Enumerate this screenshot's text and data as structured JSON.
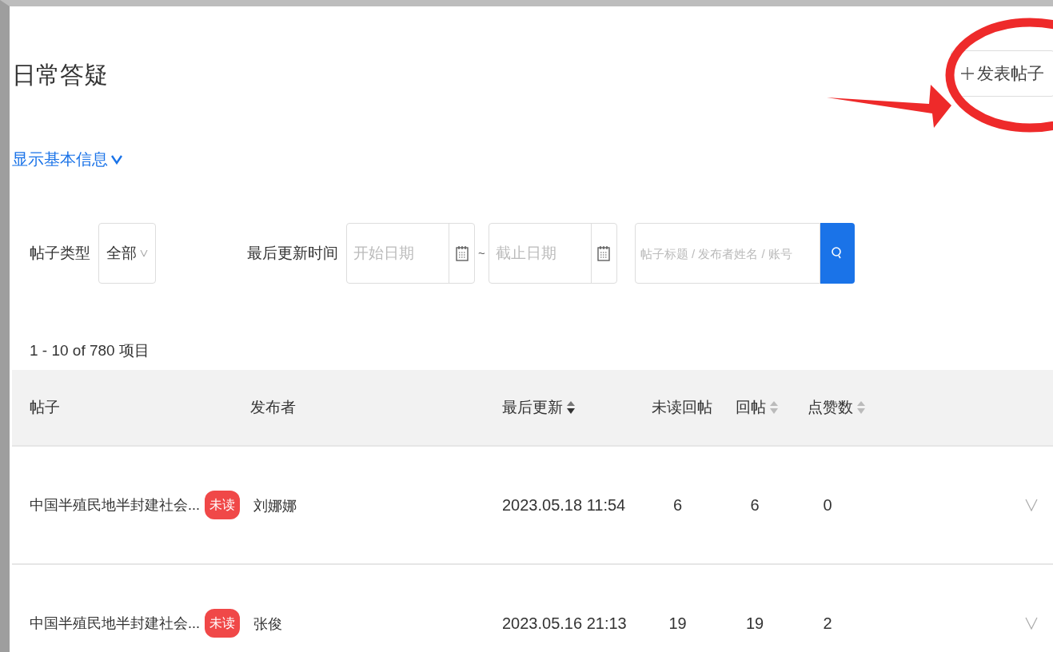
{
  "page": {
    "title": "日常答疑",
    "new_post_button": "发表帖子",
    "toggle_info": "显示基本信息",
    "toggle_expanded": false
  },
  "filters": {
    "type_label": "帖子类型",
    "type_value": "全部",
    "time_label": "最后更新时间",
    "start_placeholder": "开始日期",
    "separator": "~",
    "end_placeholder": "截止日期",
    "search_placeholder": "帖子标题 / 发布者姓名 / 账号"
  },
  "summary": "1 - 10 of 780 项目",
  "table": {
    "columns": [
      {
        "label": "帖子"
      },
      {
        "label": "发布者"
      },
      {
        "label": "最后更新",
        "sorted_desc": true
      },
      {
        "label": "未读回帖"
      },
      {
        "label": "回帖",
        "sorted_desc": false
      },
      {
        "label": "点赞数",
        "sorted_desc": false
      }
    ],
    "rows": [
      {
        "post": "中国半殖民地半封建社会...",
        "unread_badge": "未读",
        "publisher": "刘娜娜",
        "updated": "2023.05.18 11:54",
        "unread_replies": "6",
        "replies": "6",
        "likes": "0",
        "expanded": false
      },
      {
        "post": "中国半殖民地半封建社会...",
        "unread_badge": "未读",
        "publisher": "张俊",
        "updated": "2023.05.16 21:13",
        "unread_replies": "19",
        "replies": "19",
        "likes": "2",
        "expanded": false
      }
    ]
  }
}
